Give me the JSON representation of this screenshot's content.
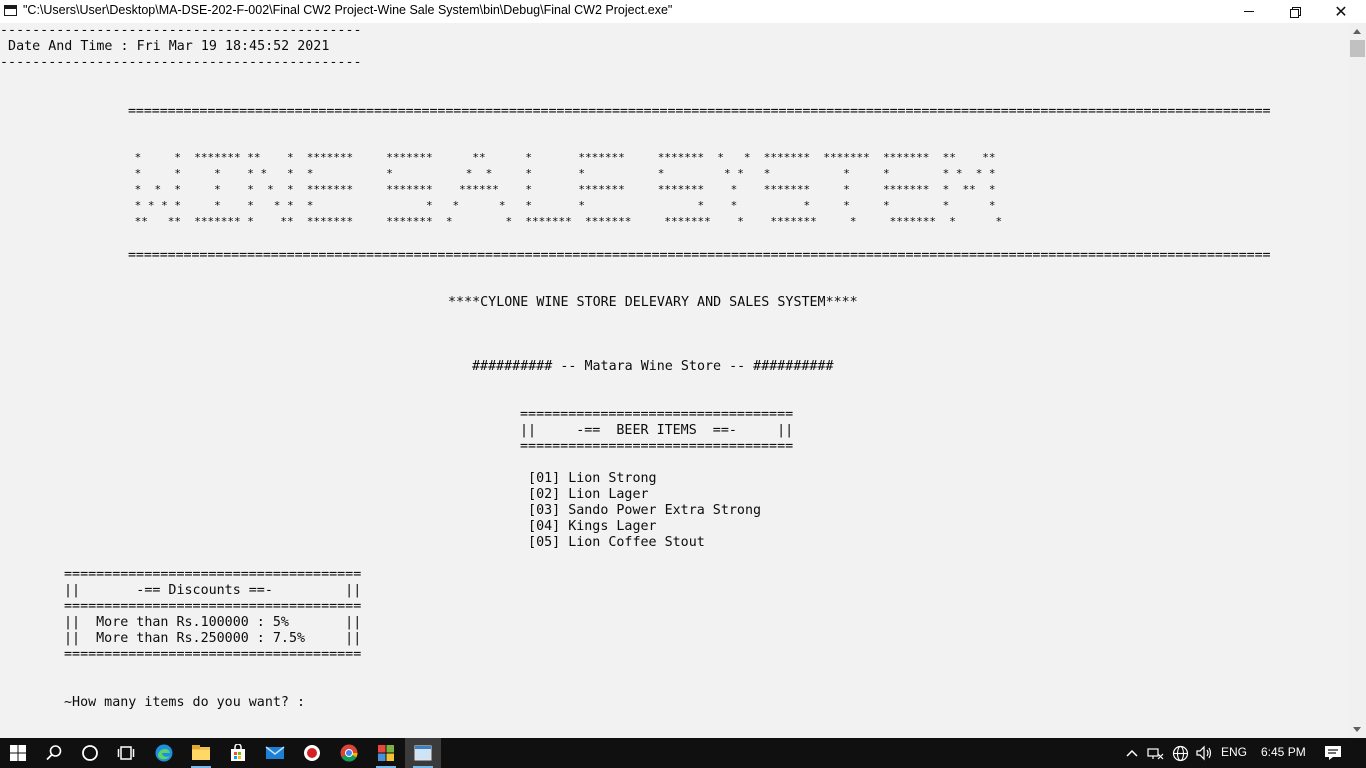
{
  "window": {
    "title": "\"C:\\Users\\User\\Desktop\\MA-DSE-202-F-002\\Final CW2 Project-Wine Sale System\\bin\\Debug\\Final CW2 Project.exe\"",
    "min_glyph": "—",
    "max_glyph": "❐",
    "close_glyph": "✕"
  },
  "console": {
    "lines": [
      "---------------------------------------------",
      " Date And Time : Fri Mar 19 18:45:52 2021",
      "---------------------------------------------",
      "================================================================================================================================================",
      " *     *  ******* **    *  *******     *******      **      *       *******     *******  *   *  *******  *******  *******  **    **",
      " *     *     *    * *   *  *           *           *  *     *       *           *         * *   *           *     *        * *  * *",
      " *  *  *     *    *  *  *  *******     *******    ******    *       *******     *******    *    *******     *     *******  *  **  *",
      " * * * *     *    *   * *  *                 *   *      *   *       *                 *    *          *     *     *        *      *",
      " **   **  ******* *    **  *******     *******  *        *  *******  *******     *******    *    *******     *     *******  *      *",
      "================================================================================================================================================",
      "****CYLONE WINE STORE DELEVARY AND SALES SYSTEM****",
      "########## -- Matara Wine Store -- ##########",
      "==================================",
      "||     -==  BEER ITEMS  ==-     ||",
      "==================================",
      " [01] Lion Strong",
      " [02] Lion Lager",
      " [03] Sando Power Extra Strong",
      " [04] Kings Lager",
      " [05] Lion Coffee Stout",
      "=====================================",
      "||       -== Discounts ==-         ||",
      "=====================================",
      "||  More than Rs.100000 : 5%       ||",
      "||  More than Rs.250000 : 7.5%     ||",
      "=====================================",
      "~How many items do you want? :"
    ]
  },
  "taskbar": {
    "tray": {
      "language": "ENG",
      "time": "6:45 PM"
    }
  }
}
